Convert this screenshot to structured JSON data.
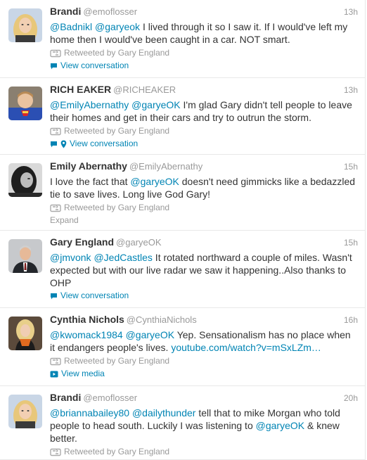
{
  "tweets": [
    {
      "name": "Brandi",
      "handle": "@emoflosser",
      "time": "13h",
      "text": [
        {
          "t": "@Badnikl",
          "k": "mention"
        },
        {
          "t": " "
        },
        {
          "t": "@garyeok",
          "k": "mention"
        },
        {
          "t": " I lived through it so I saw it.  If I would've left my home then I would've been caught in a car. NOT smart."
        }
      ],
      "retweeted_by": "Retweeted by Gary England",
      "action": "View conversation",
      "action_icons": [
        "speech-bubble-icon"
      ]
    },
    {
      "name": "RICH EAKER",
      "handle": "@RICHEAKER",
      "time": "13h",
      "text": [
        {
          "t": "@EmilyAbernathy",
          "k": "mention"
        },
        {
          "t": " "
        },
        {
          "t": "@garyeOK",
          "k": "mention"
        },
        {
          "t": " I'm glad Gary didn't tell people to leave their homes and get in their cars and try to outrun the storm."
        }
      ],
      "retweeted_by": "Retweeted by Gary England",
      "action": "View conversation",
      "action_icons": [
        "speech-bubble-icon",
        "location-pin-icon"
      ]
    },
    {
      "name": "Emily Abernathy",
      "handle": "@EmilyAbernathy",
      "time": "15h",
      "text": [
        {
          "t": "I love the fact that "
        },
        {
          "t": "@garyeOK",
          "k": "mention"
        },
        {
          "t": " doesn't need gimmicks like a bedazzled tie to save lives. Long live God Gary!"
        }
      ],
      "retweeted_by": "Retweeted by Gary England",
      "action": "Expand",
      "action_icons": []
    },
    {
      "name": "Gary England",
      "handle": "@garyeOK",
      "time": "15h",
      "text": [
        {
          "t": "@jmvonk",
          "k": "mention"
        },
        {
          "t": " "
        },
        {
          "t": "@JedCastles",
          "k": "mention"
        },
        {
          "t": "  It rotated northward a couple of miles. Wasn't expected but with our live radar we saw it happening..Also thanks to OHP"
        }
      ],
      "retweeted_by": "",
      "action": "View conversation",
      "action_icons": [
        "speech-bubble-icon"
      ]
    },
    {
      "name": "Cynthia Nichols",
      "handle": "@CynthiaNichols",
      "time": "16h",
      "text": [
        {
          "t": "@kwomack1984",
          "k": "mention"
        },
        {
          "t": " "
        },
        {
          "t": "@garyeOK",
          "k": "mention"
        },
        {
          "t": " Yep. Sensationalism has no place when it endangers people's lives. "
        },
        {
          "t": "youtube.com/watch?v=mSxLZm…",
          "k": "link"
        }
      ],
      "retweeted_by": "Retweeted by Gary England",
      "action": "View media",
      "action_icons": [
        "video-play-icon"
      ]
    },
    {
      "name": "Brandi",
      "handle": "@emoflosser",
      "time": "20h",
      "text": [
        {
          "t": "@briannabailey80",
          "k": "mention"
        },
        {
          "t": " "
        },
        {
          "t": "@dailythunder",
          "k": "mention"
        },
        {
          "t": " tell that to mike Morgan who told people to head south.  Luckily I was listening to "
        },
        {
          "t": "@garyeOK",
          "k": "mention"
        },
        {
          "t": " & knew better."
        }
      ],
      "retweeted_by": "Retweeted by Gary England",
      "action": "",
      "action_icons": []
    }
  ],
  "colors": {
    "link": "#0084b4",
    "muted": "#999999",
    "text": "#333333",
    "divider": "#e8e8e8"
  }
}
